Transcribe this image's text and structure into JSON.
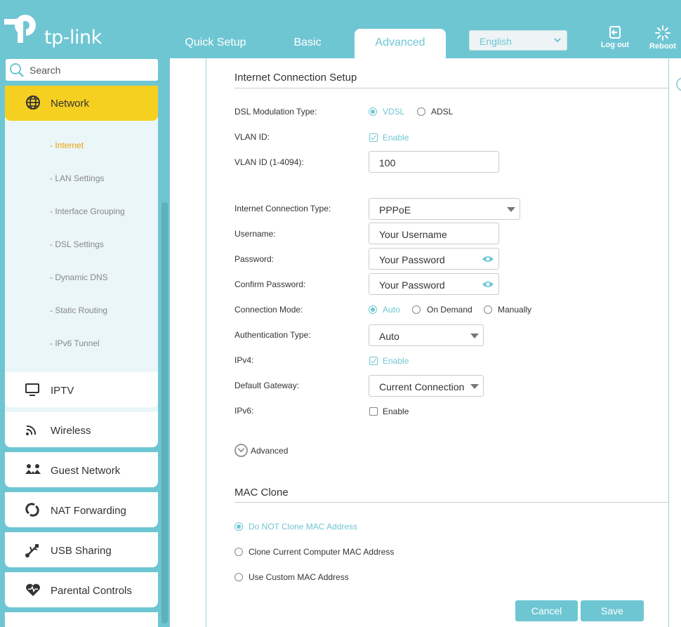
{
  "brand": {
    "name": "tp-link",
    "accent": "#6fc6d3",
    "highlight": "#f5d020"
  },
  "nav": {
    "tabs": [
      {
        "label": "Quick Setup"
      },
      {
        "label": "Basic"
      },
      {
        "label": "Advanced",
        "active": true
      }
    ]
  },
  "language": {
    "selected": "English"
  },
  "header_actions": {
    "logout": "Log out",
    "reboot": "Reboot"
  },
  "sidebar": {
    "search_placeholder": "Search",
    "network": {
      "label": "Network",
      "icon": "globe-icon",
      "items": [
        "- Internet",
        "- LAN Settings",
        "- Interface Grouping",
        "- DSL Settings",
        "- Dynamic DNS",
        "- Static Routing",
        "- IPv6 Tunnel"
      ],
      "active_item": "- Internet"
    },
    "items": [
      {
        "label": "IPTV",
        "icon": "monitor-icon"
      },
      {
        "label": "Wireless",
        "icon": "wifi-icon"
      },
      {
        "label": "Guest Network",
        "icon": "guest-icon"
      },
      {
        "label": "NAT Forwarding",
        "icon": "nat-icon"
      },
      {
        "label": "USB Sharing",
        "icon": "usb-icon"
      },
      {
        "label": "Parental Controls",
        "icon": "heart-icon"
      }
    ]
  },
  "internet_setup": {
    "title": "Internet Connection Setup",
    "dsl_modulation": {
      "label": "DSL Modulation Type:",
      "options": [
        "VDSL",
        "ADSL"
      ],
      "selected": "VDSL"
    },
    "vlan": {
      "label": "VLAN ID:",
      "checkbox": "Enable",
      "checked": true
    },
    "vlan_id": {
      "label": "VLAN ID (1-4094):",
      "value": "100"
    },
    "conn_type": {
      "label": "Internet Connection Type:",
      "value": "PPPoE"
    },
    "username": {
      "label": "Username:",
      "value": "Your Username"
    },
    "password": {
      "label": "Password:",
      "value": "Your Password"
    },
    "confirm_password": {
      "label": "Confirm Password:",
      "value": "Your Password"
    },
    "conn_mode": {
      "label": "Connection Mode:",
      "options": [
        "Auto",
        "On Demand",
        "Manually"
      ],
      "selected": "Auto"
    },
    "auth_type": {
      "label": "Authentication Type:",
      "value": "Auto"
    },
    "ipv4": {
      "label": "IPv4:",
      "checkbox": "Enable",
      "checked": true
    },
    "gateway": {
      "label": "Default Gateway:",
      "value": "Current Connection"
    },
    "ipv6": {
      "label": "IPv6:",
      "checkbox": "Enable",
      "checked": false
    },
    "advanced_label": "Advanced"
  },
  "mac_clone": {
    "title": "MAC Clone",
    "options": [
      "Do NOT Clone MAC Address",
      "Clone Current Computer MAC Address",
      "Use Custom MAC Address"
    ],
    "selected": "Do NOT Clone MAC Address"
  },
  "actions": {
    "cancel": "Cancel",
    "save": "Save"
  }
}
